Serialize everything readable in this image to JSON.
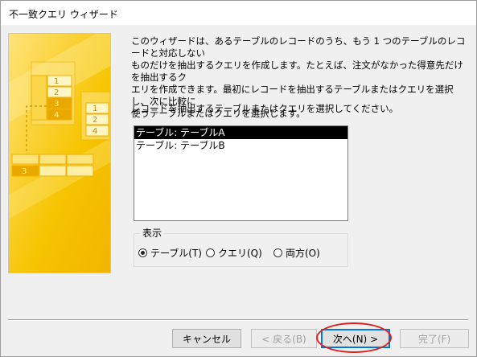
{
  "window": {
    "title": "不一致クエリ ウィザード"
  },
  "description": "このウィザードは、あるテーブルのレコードのうち、もう 1 つのテーブルのレコードと対応しない\nものだけを抽出するクエリを作成します。たとえば、注文がなかった得意先だけを抽出するク\nエリを作成できます。最初にレコードを抽出するテーブルまたはクエリを選択し、次に比較に\n使うテーブルまたはクエリを選択します。",
  "prompt": "レコードを抽出するテーブルまたはクエリを選択してください。",
  "list": {
    "items": [
      {
        "label": "テーブル: テーブルA",
        "selected": true
      },
      {
        "label": "テーブル: テーブルB",
        "selected": false
      }
    ]
  },
  "view_group": {
    "label": "表示",
    "options": [
      {
        "label": "テーブル(T)",
        "accel": "T",
        "checked": true
      },
      {
        "label": "クエリ(Q)",
        "accel": "Q",
        "checked": false
      },
      {
        "label": "両方(O)",
        "accel": "O",
        "checked": false
      }
    ]
  },
  "illustration": {
    "numbers_left": [
      "1",
      "2",
      "3",
      "4"
    ],
    "numbers_right": [
      "1",
      "2",
      "4"
    ],
    "number_bottom": "3"
  },
  "buttons": {
    "cancel": "キャンセル",
    "back": "< 戻る(B)",
    "next": "次へ(N) >",
    "finish": "完了(F)"
  },
  "colors": {
    "illustration_bg": "#f6c400",
    "selection": "#000000",
    "default_button_border": "#0078d7",
    "annotation_ellipse": "#e02020"
  }
}
